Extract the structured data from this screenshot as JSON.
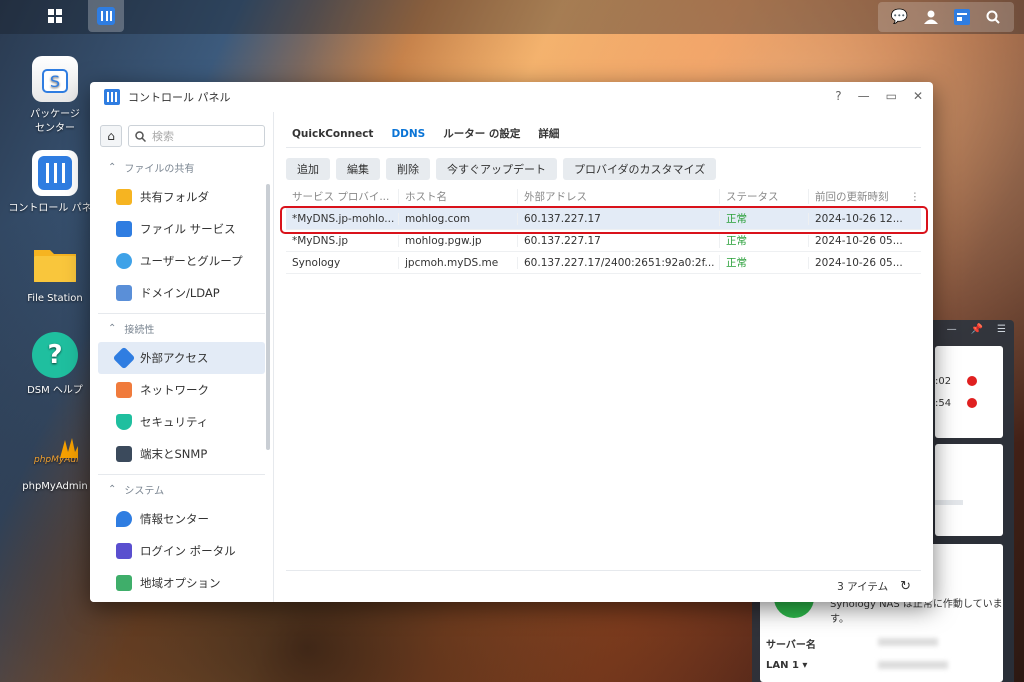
{
  "desktop": {
    "icons": [
      {
        "label": "パッケージ\nセンター"
      },
      {
        "label": "コントロール パネル"
      },
      {
        "label": "File Station"
      },
      {
        "label": "DSM ヘルプ"
      },
      {
        "label": "phpMyAdmin"
      }
    ]
  },
  "window": {
    "title": "コントロール パネル",
    "help": "?"
  },
  "sidebar": {
    "search_placeholder": "検索",
    "sections": [
      {
        "title": "ファイルの共有",
        "items": [
          "共有フォルダ",
          "ファイル サービス",
          "ユーザーとグループ",
          "ドメイン/LDAP"
        ]
      },
      {
        "title": "接続性",
        "items": [
          "外部アクセス",
          "ネットワーク",
          "セキュリティ",
          "端末とSNMP"
        ]
      },
      {
        "title": "システム",
        "items": [
          "情報センター",
          "ログイン ポータル",
          "地域オプション"
        ]
      }
    ]
  },
  "tabs": [
    "QuickConnect",
    "DDNS",
    "ルーター の設定",
    "詳細"
  ],
  "toolbar": [
    "追加",
    "編集",
    "削除",
    "今すぐアップデート",
    "プロバイダのカスタマイズ"
  ],
  "table": {
    "columns": [
      "サービス プロバイ...",
      "ホスト名",
      "外部アドレス",
      "ステータス",
      "前回の更新時刻"
    ],
    "rows": [
      [
        "*MyDNS.jp-mohlo...",
        "mohlog.com",
        "60.137.227.17",
        "正常",
        "2024-10-26 12..."
      ],
      [
        "*MyDNS.jp",
        "mohlog.pgw.jp",
        "60.137.227.17",
        "正常",
        "2024-10-26 05..."
      ],
      [
        "Synology",
        "jpcmoh.myDS.me",
        "60.137.227.17/2400:2651:92a0:2f...",
        "正常",
        "2024-10-26 05..."
      ]
    ]
  },
  "footer": {
    "count": "3 アイテム"
  },
  "widget": {
    "time1": ":02",
    "time2": ":54",
    "status": "Synology NAS は正常に作動していま\nす。",
    "server_label": "サーバー名",
    "lan_label": "LAN 1 ▾"
  }
}
